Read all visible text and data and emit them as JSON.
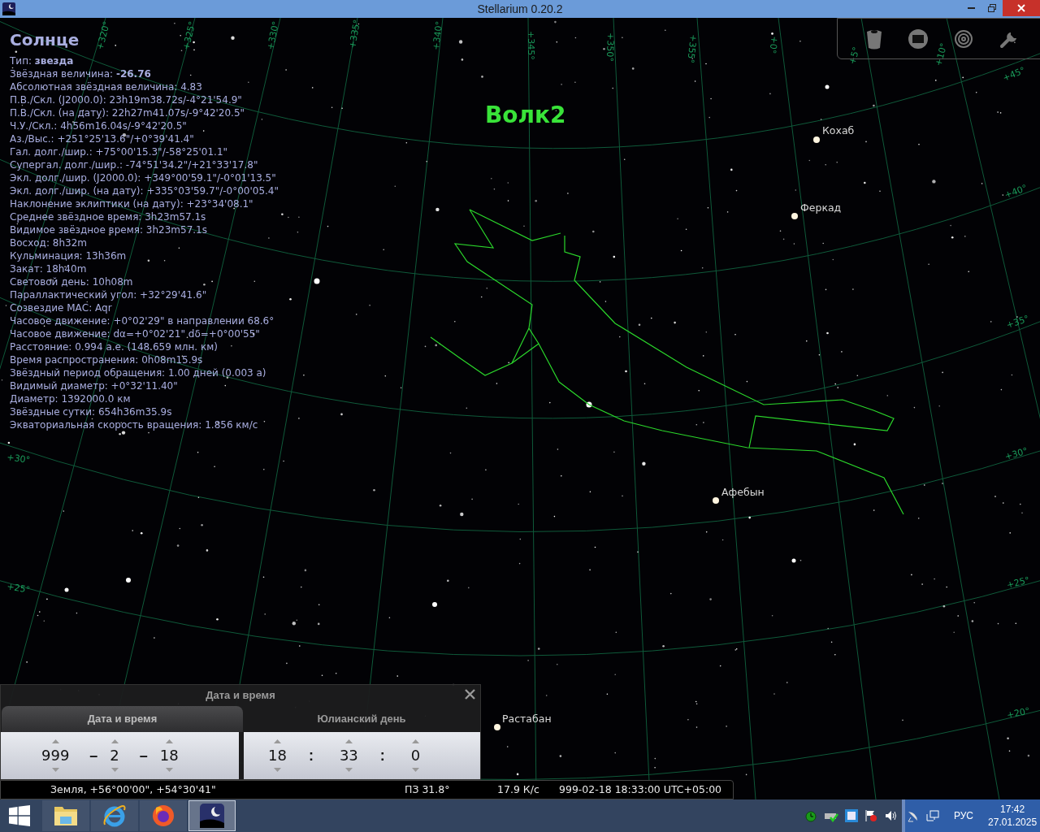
{
  "window": {
    "title": "Stellarium 0.20.2"
  },
  "object_info": {
    "name": "Солнце",
    "lines": [
      "Тип: **звезда**",
      "Звёздная величина: **-26.76**",
      "Абсолютная звёздная величина: 4.83",
      "П.В./Скл. (J2000.0): 23h19m38.72s/-4°21'54.9\"",
      "П.В./Скл. (на дату): 22h27m41.07s/-9°42'20.5\"",
      "Ч.У./Скл.: 4h56m16.04s/-9°42'20.5\"",
      "Аз./Выс.: +251°25'13.6\"/+0°39'41.4\"",
      "Гал. долг./шир.: +75°00'15.3\"/-58°25'01.1\"",
      "Супергал. долг./шир.: -74°51'34.2\"/+21°33'17.8\"",
      "Экл. долг./шир. (J2000.0): +349°00'59.1\"/-0°01'13.5\"",
      "Экл. долг./шир. (на дату): +335°03'59.7\"/-0°00'05.4\"",
      "Наклонение эклиптики (на дату): +23°34'08.1\"",
      "Среднее звёздное время: 3h23m57.1s",
      "Видимое звёздное время: 3h23m57.1s",
      "Восход: 8h32m",
      "Кульминация: 13h36m",
      "Закат: 18h40m",
      "Световой день: 10h08m",
      "Параллактический угол: +32°29'41.6\"",
      "Созвездие МАС: Aqr",
      "Часовое движение: +0°02'29\" в направлении 68.6°",
      "Часовое движение: dα=+0°02'21\" dδ=+0°00'55\"",
      "Расстояние: 0.994 а.е. (148.659 млн. км)",
      "Время распространения: 0h08m15.9s",
      "Звёздный период обращения: 1.00 дней (0.003 а)",
      "Видимый диаметр: +0°32'11.40\"",
      "Диаметр: 1392000.0 км",
      "Звёздные сутки: 654h36m35.9s",
      "Экваториальная скорость вращения: 1.856 км/с"
    ]
  },
  "sky": {
    "constellation": "Волк2",
    "stars": [
      "Кохаб",
      "Феркад",
      "Афебын",
      "Растабан"
    ],
    "grid_labels": [
      "+320°",
      "+325°",
      "+330°",
      "+335°",
      "+340°",
      "+345°",
      "+350°",
      "+355°",
      "+0°",
      "+5°",
      "+10°",
      "+45°",
      "+40°",
      "+35°",
      "+30°",
      "+25°",
      "+20°",
      "+30°",
      "+25°"
    ]
  },
  "date_dialog": {
    "title": "Дата и время",
    "tabs": [
      {
        "label": "Дата и время",
        "selected": true
      },
      {
        "label": "Юлианский день",
        "selected": false
      }
    ],
    "date": [
      "999",
      "2",
      "18"
    ],
    "date_separators": [
      "–",
      "–"
    ],
    "time": [
      "18",
      "33",
      "0"
    ],
    "time_separators": [
      ":",
      ":"
    ]
  },
  "status_bar": {
    "location": "Земля, +56°00'00\", +54°30'41\"",
    "fov": "ПЗ 31.8°",
    "fps": "17.9 К/с",
    "datetime": "999-02-18 18:33:00 UTC+05:00"
  },
  "taskbar": {
    "apps": [
      {
        "kind": "explorer",
        "selected": false
      },
      {
        "kind": "ie",
        "selected": false
      },
      {
        "kind": "firefox",
        "selected": false
      },
      {
        "kind": "stellarium",
        "selected": true
      }
    ],
    "language": "РУС",
    "time": "17:42",
    "date": "27.01.2025"
  }
}
